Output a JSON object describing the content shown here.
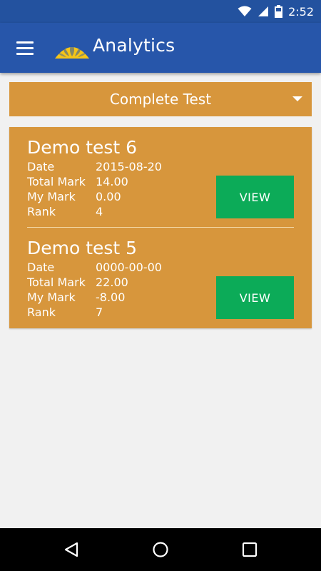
{
  "status_bar": {
    "time": "2:52",
    "icons": [
      "wifi-icon",
      "signal-icon",
      "battery-icon"
    ]
  },
  "app_bar": {
    "title": "Analytics",
    "menu_icon": "hamburger-menu-icon",
    "logo_icon": "lotus-logo-icon"
  },
  "filter": {
    "selected": "Complete Test",
    "icon": "dropdown-arrow-icon"
  },
  "labels": {
    "date": "Date",
    "total_mark": "Total Mark",
    "my_mark": "My Mark",
    "rank": "Rank"
  },
  "tests": [
    {
      "name": "Demo test 6",
      "date": "2015-08-20",
      "total_mark": "14.00",
      "my_mark": "0.00",
      "rank": "4",
      "button": "VIEW"
    },
    {
      "name": "Demo test 5",
      "date": "0000-00-00",
      "total_mark": "22.00",
      "my_mark": "-8.00",
      "rank": "7",
      "button": "VIEW"
    }
  ],
  "nav_bar": {
    "icons": [
      "back-icon",
      "home-icon",
      "recent-apps-icon"
    ]
  },
  "colors": {
    "status_bar": "#23529f",
    "app_bar": "#2756aa",
    "accent_orange": "#d7963c",
    "view_button": "#0cab58",
    "background": "#f1f1f1",
    "logo_yellow": "#f5c518"
  }
}
